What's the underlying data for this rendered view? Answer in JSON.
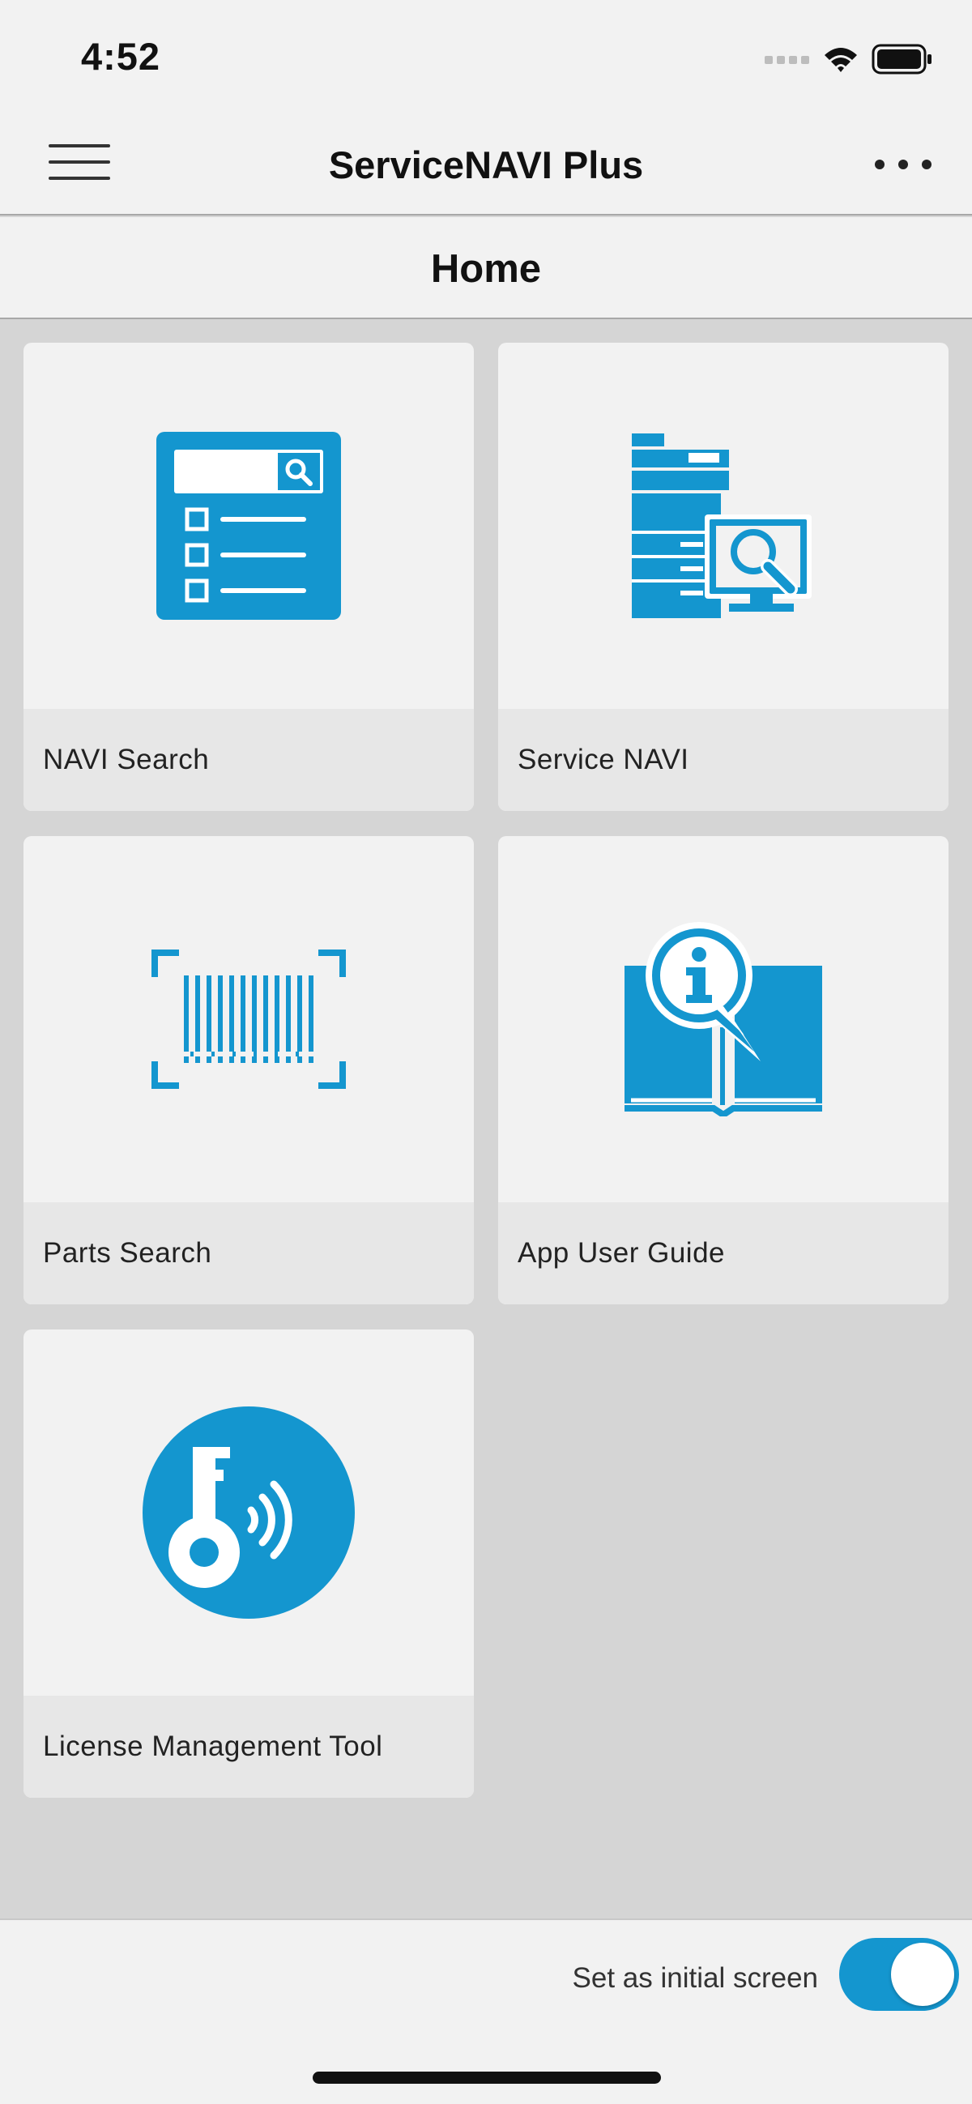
{
  "status": {
    "time": "4:52"
  },
  "app": {
    "title": "ServiceNAVI Plus"
  },
  "page": {
    "title": "Home"
  },
  "colors": {
    "accent": "#1496cf",
    "tile_bg": "#f2f2f2",
    "label_bg": "#e7e7e7",
    "screen_bg": "#d5d5d5"
  },
  "tiles": [
    {
      "label": "NAVI Search",
      "icon": "search-list-icon"
    },
    {
      "label": "Service NAVI",
      "icon": "copier-search-icon"
    },
    {
      "label": "Parts Search",
      "icon": "barcode-scan-icon"
    },
    {
      "label": "App User Guide",
      "icon": "info-book-icon"
    },
    {
      "label": "License Management Tool",
      "icon": "key-wireless-icon"
    }
  ],
  "footer": {
    "toggle_label": "Set as initial screen",
    "toggle_on": true
  }
}
